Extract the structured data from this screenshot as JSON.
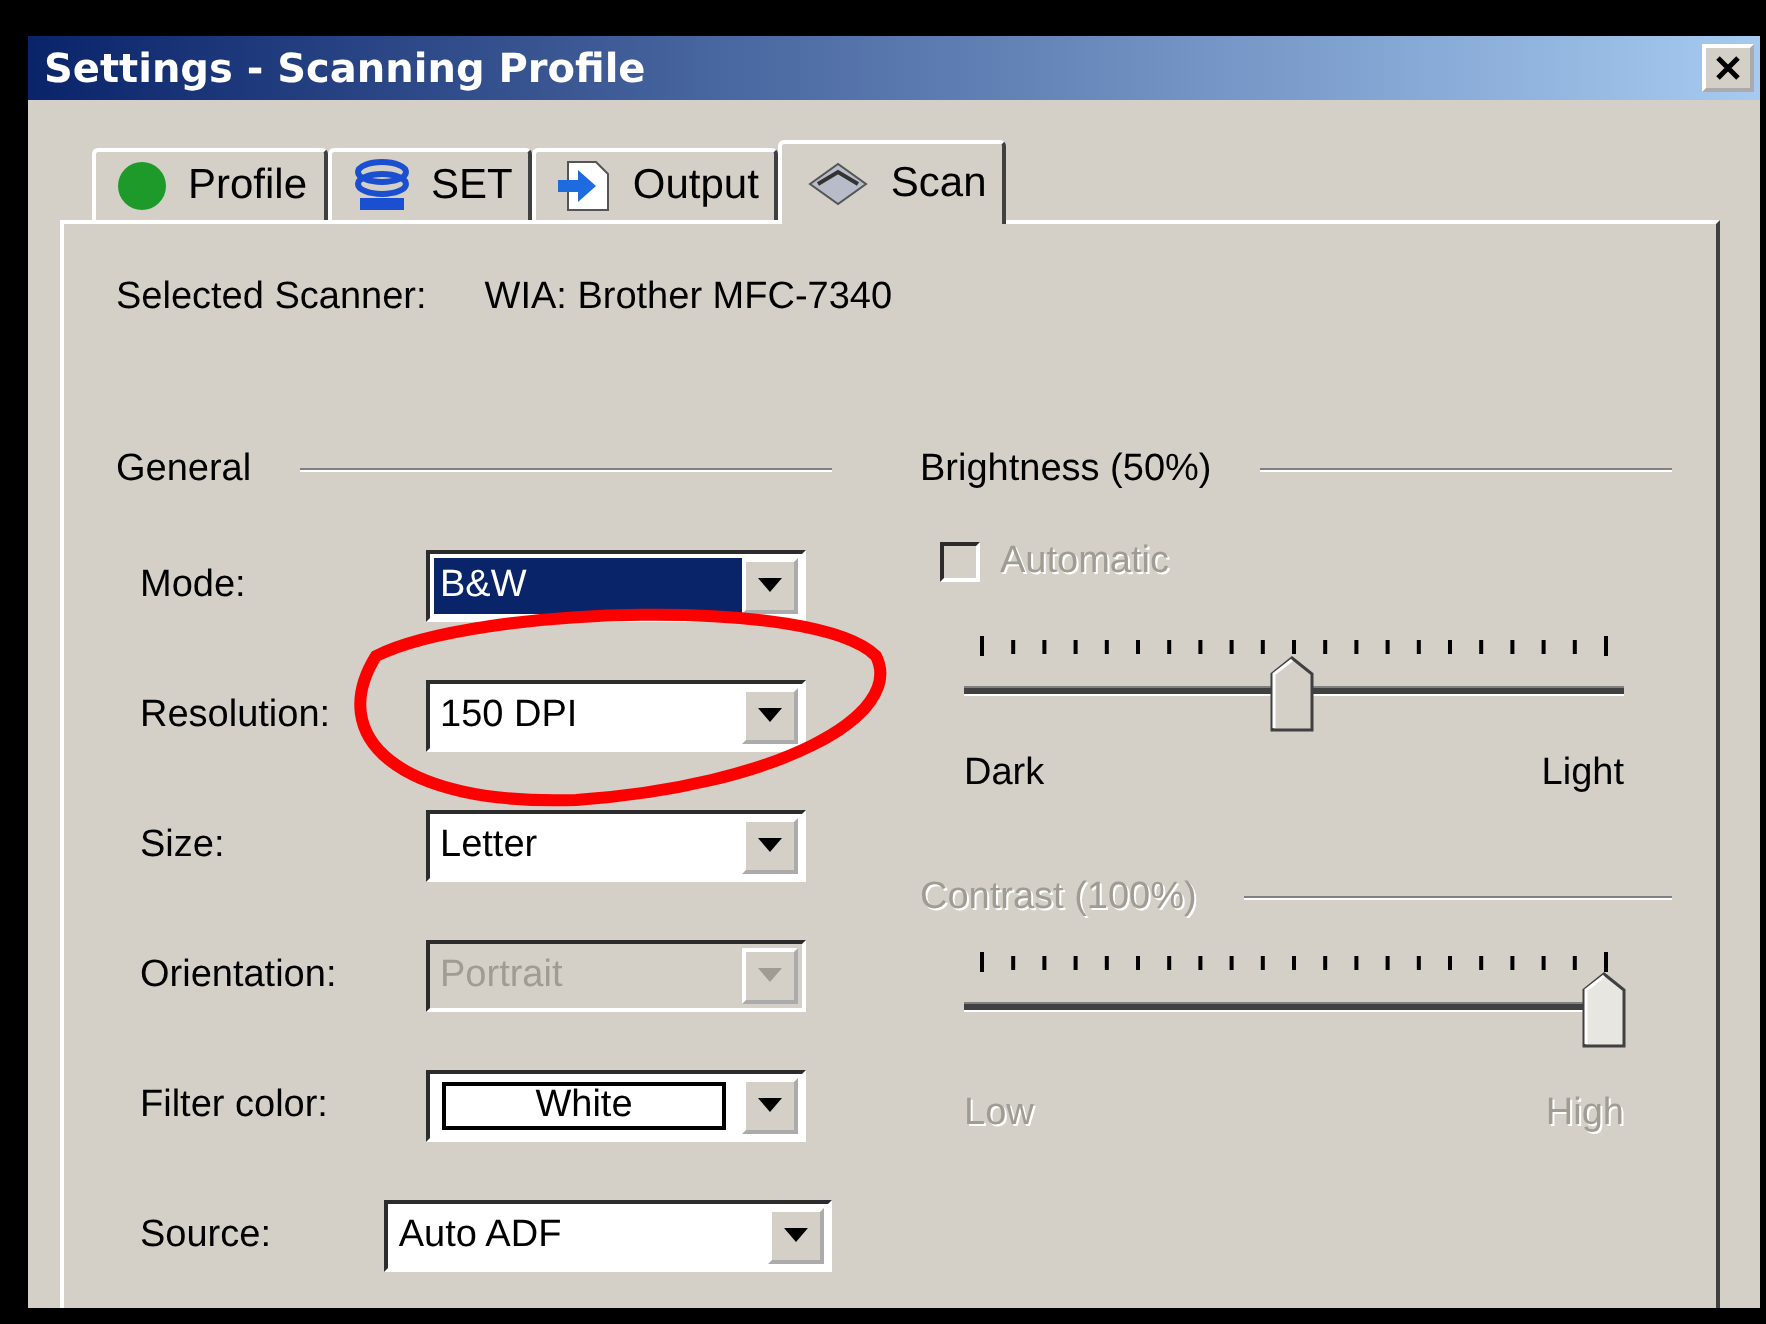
{
  "window": {
    "title": "Settings - Scanning Profile"
  },
  "tabs": [
    {
      "label": "Profile",
      "selected": false
    },
    {
      "label": "SET",
      "selected": false
    },
    {
      "label": "Output",
      "selected": false
    },
    {
      "label": "Scan",
      "selected": true
    }
  ],
  "scanner": {
    "label": "Selected Scanner:",
    "value": "WIA: Brother MFC-7340"
  },
  "general": {
    "title": "General",
    "fields": [
      {
        "label": "Mode:",
        "value": "B&W",
        "kind": "combo",
        "highlighted": true,
        "disabled": false
      },
      {
        "label": "Resolution:",
        "value": "150 DPI",
        "kind": "combo",
        "disabled": false
      },
      {
        "label": "Size:",
        "value": "Letter",
        "kind": "combo",
        "disabled": false
      },
      {
        "label": "Orientation:",
        "value": "Portrait",
        "kind": "combo",
        "disabled": true
      },
      {
        "label": "Filter color:",
        "value": "White",
        "kind": "color",
        "disabled": false
      },
      {
        "label": "Source:",
        "value": "Auto ADF",
        "kind": "wide",
        "disabled": false
      }
    ]
  },
  "brightness": {
    "title": "Brightness (50%)",
    "disabled": false,
    "automatic": {
      "label": "Automatic",
      "checked": false,
      "disabled": true
    },
    "level": 0.5,
    "min_label": "Dark",
    "max_label": "Light"
  },
  "contrast": {
    "title": "Contrast (100%)",
    "disabled": true,
    "level": 1,
    "min_label": "Low",
    "max_label": "High"
  }
}
